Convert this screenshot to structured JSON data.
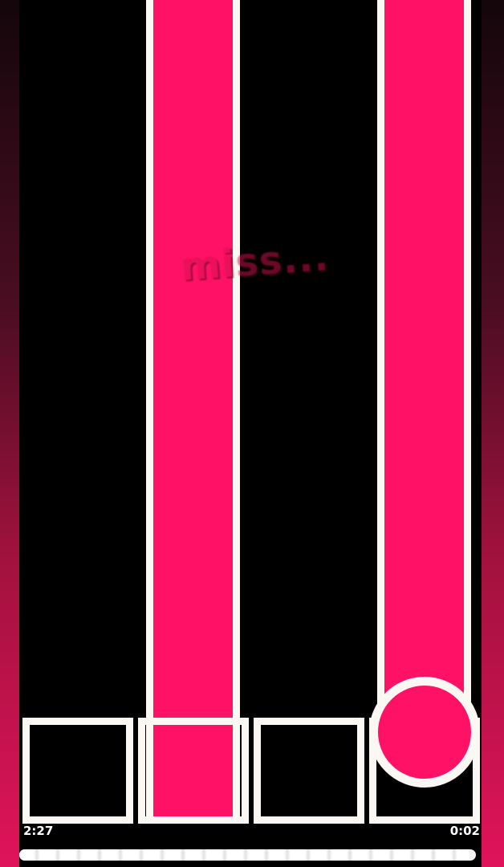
{
  "colors": {
    "accent": "#ff1166",
    "outline": "#fbf7f2",
    "background": "#000000",
    "judgement_text": "#d81050"
  },
  "lanes": [
    {
      "lane": 1,
      "hold_note": false,
      "receptor_filled": false,
      "tap_note": false
    },
    {
      "lane": 2,
      "hold_note": true,
      "receptor_filled": true,
      "tap_note": false
    },
    {
      "lane": 3,
      "hold_note": false,
      "receptor_filled": false,
      "tap_note": false
    },
    {
      "lane": 4,
      "hold_note": true,
      "receptor_filled": false,
      "tap_note": true
    }
  ],
  "judgement": {
    "text": "miss..."
  },
  "time": {
    "elapsed": "2:27",
    "remaining": "0:02"
  },
  "progress": {
    "fraction": 0.986
  }
}
